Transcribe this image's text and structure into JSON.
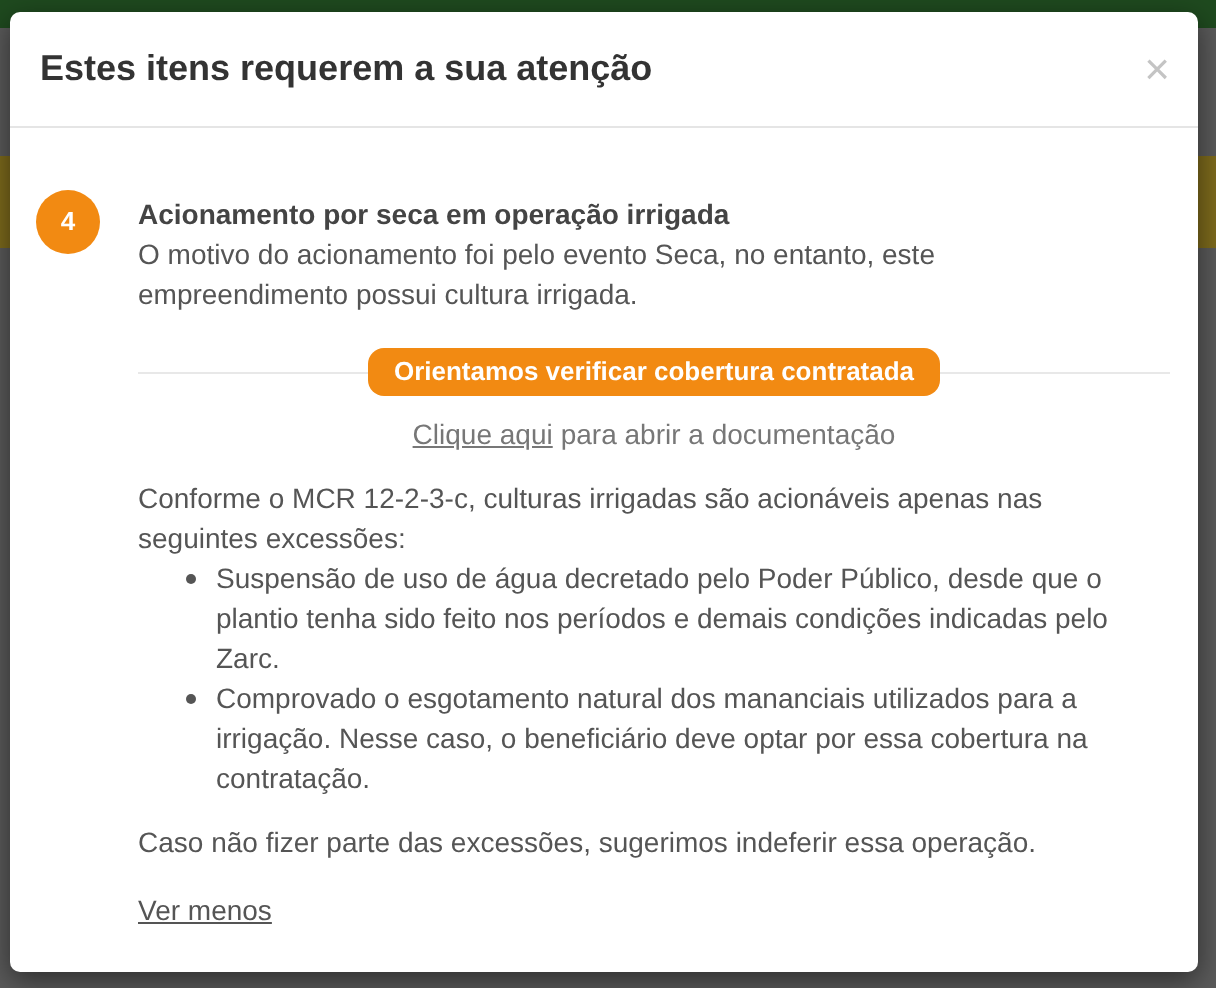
{
  "dialog": {
    "title": "Estes itens requerem a sua atenção",
    "close": "×",
    "items": [
      {
        "number": "4",
        "title": "Acionamento por seca em operação irrigada",
        "description": "O motivo do acionamento foi pelo evento Seca, no entanto, este empreendimento possui cultura irrigada.",
        "action_button": "Orientamos verificar cobertura contratada",
        "doc_link": "Clique aqui",
        "doc_text": "para abrir a documentação",
        "intro": "Conforme o MCR 12-2-3-c, culturas irrigadas são acionáveis apenas nas seguintes excessões:",
        "bullets": [
          "Suspensão de uso de água decretado pelo Poder Público, desde que o plantio tenha sido feito nos períodos e demais condições indicadas pelo Zarc.",
          "Comprovado o esgotamento natural dos mananciais utilizados para a irrigação. Nesse caso, o beneficiário deve optar por essa cobertura na contratação."
        ],
        "conclusion": "Caso não fizer parte das excessões, sugerimos indeferir essa operação.",
        "toggle": "Ver menos"
      }
    ]
  }
}
